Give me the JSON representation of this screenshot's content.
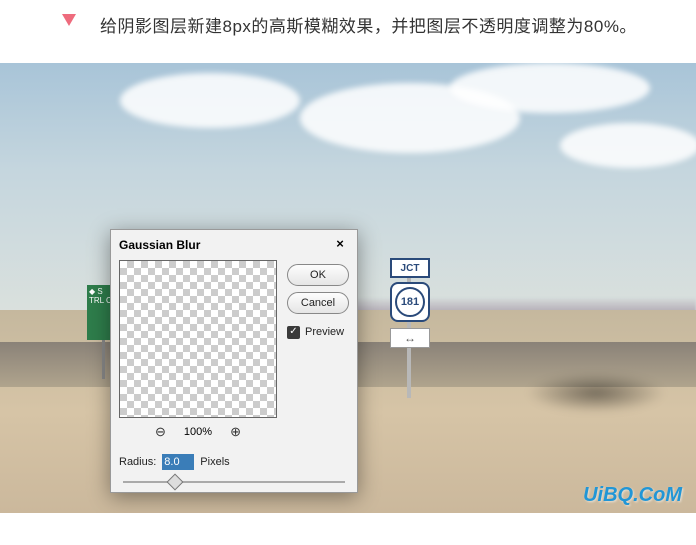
{
  "instruction": {
    "text": "给阴影图层新建8px的高斯模糊效果，并把图层不透明度调整为80%。"
  },
  "dialog": {
    "title": "Gaussian Blur",
    "close_label": "×",
    "ok_label": "OK",
    "cancel_label": "Cancel",
    "preview_label": "Preview",
    "zoom_out_label": "⊖",
    "zoom_level": "100%",
    "zoom_in_label": "⊕",
    "radius_label": "Radius:",
    "radius_value": "8.0",
    "radius_unit": "Pixels"
  },
  "signs": {
    "jct": "JCT",
    "route": "181",
    "arrows": "↔",
    "green": "◆ S\nTRL\nCO"
  },
  "watermark": "UiBQ.CoM"
}
